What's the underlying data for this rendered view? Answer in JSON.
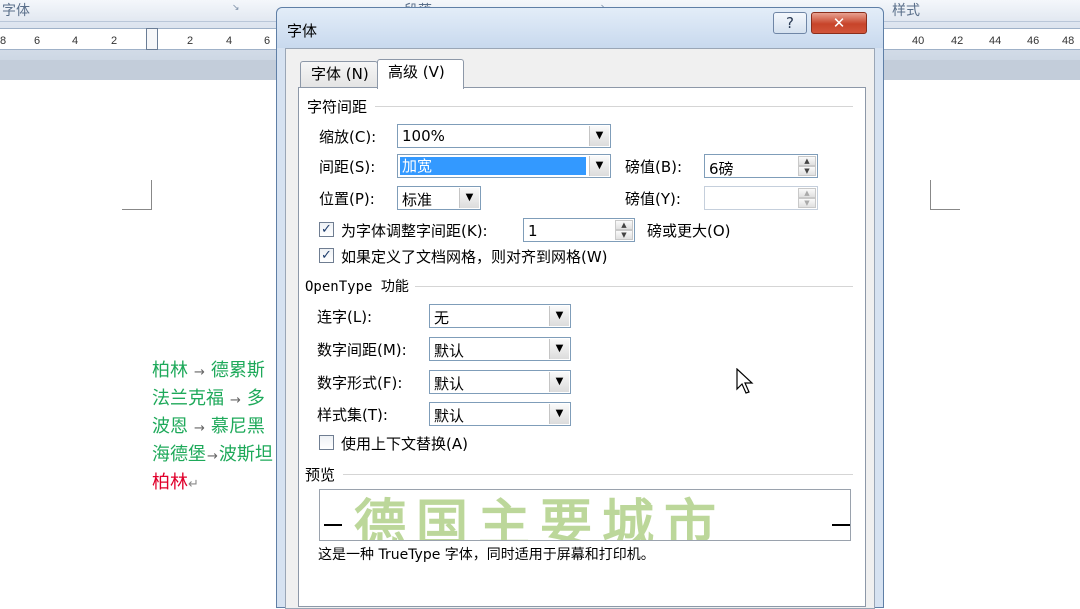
{
  "background": {
    "ribbon": {
      "group_font": "字体",
      "group_paragraph": "段落",
      "group_styles": "样式"
    },
    "ruler": {
      "left_ticks": [
        "8",
        "6",
        "4",
        "2"
      ],
      "mid_ticks": [
        "2",
        "4",
        "6"
      ],
      "right_ticks": [
        "40",
        "42",
        "44",
        "46",
        "48"
      ]
    },
    "document_lines": [
      {
        "parts": [
          "柏林",
          "→",
          "德累斯"
        ],
        "color": "#1ea95a"
      },
      {
        "parts": [
          "法兰克福",
          "→",
          "多"
        ],
        "color": "#1ea95a"
      },
      {
        "parts": [
          "波恩",
          "→",
          "慕尼黑"
        ],
        "color": "#1ea95a"
      },
      {
        "parts": [
          "海德堡",
          "→",
          "波斯坦"
        ],
        "color": "#1ea95a"
      },
      {
        "parts": [
          "柏林",
          "↵"
        ],
        "color": "#e0002b"
      }
    ]
  },
  "dialog": {
    "title": "字体",
    "help_icon": "?",
    "close_icon": "✕",
    "tabs": [
      {
        "label": "字体 (N)",
        "active": false
      },
      {
        "label": "高级 (V)",
        "active": true
      }
    ],
    "char_spacing": {
      "heading": "字符间距",
      "scale_label": "缩放(C):",
      "scale_value": "100%",
      "spacing_label": "间距(S):",
      "spacing_value": "加宽",
      "spacing_by_label": "磅值(B):",
      "spacing_by_value": "6磅",
      "position_label": "位置(P):",
      "position_value": "标准",
      "position_by_label": "磅值(Y):",
      "position_by_value": "",
      "kerning_label": "为字体调整字间距(K):",
      "kerning_checked": true,
      "kerning_value": "1",
      "kerning_suffix": "磅或更大(O)",
      "grid_label": "如果定义了文档网格，则对齐到网格(W)",
      "grid_checked": true
    },
    "opentype": {
      "heading": "OpenType 功能",
      "ligatures_label": "连字(L):",
      "ligatures_value": "无",
      "num_spacing_label": "数字间距(M):",
      "num_spacing_value": "默认",
      "num_forms_label": "数字形式(F):",
      "num_forms_value": "默认",
      "stylistic_sets_label": "样式集(T):",
      "stylistic_sets_value": "默认",
      "contextual_label": "使用上下文替换(A)",
      "contextual_checked": false
    },
    "preview": {
      "heading": "预览",
      "sample_text": "德国主要城市",
      "note": "这是一种 TrueType 字体，同时适用于屏幕和打印机。"
    }
  },
  "colors": {
    "selection": "#3399ff",
    "green_text": "#1ea95a",
    "red_text": "#e0002b",
    "preview_text": "#bcd79a",
    "close_button": "#c7442a"
  }
}
